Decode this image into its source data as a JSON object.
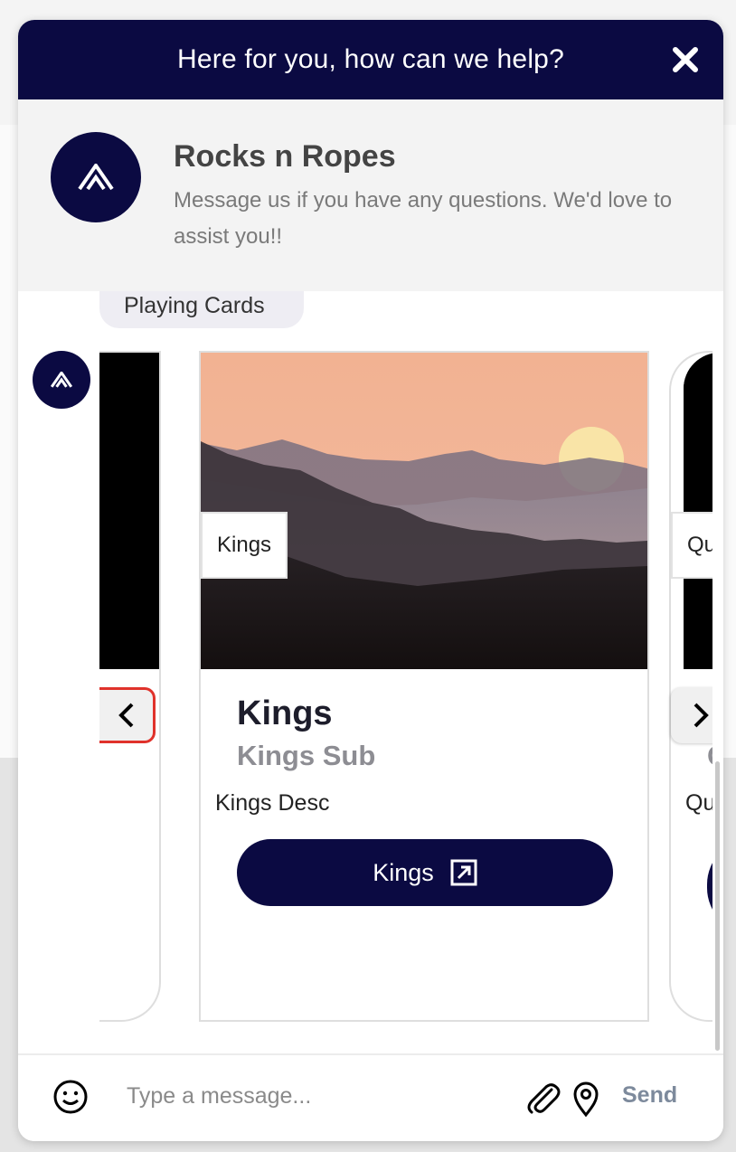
{
  "header": {
    "title": "Here for you, how can we help?"
  },
  "profile": {
    "name": "Rocks n Ropes",
    "description": "Message us if you have any questions. We'd love to assist you!!"
  },
  "conversation": {
    "previous_message": "Playing Cards"
  },
  "carousel": {
    "cards": [
      {
        "image_label": "Kings",
        "title": "Kings",
        "subtitle": "Kings Sub",
        "description": "Kings Desc",
        "button_label": "Kings",
        "button_icon": "external-link-icon"
      },
      {
        "image_label": "Que",
        "title": "Q",
        "description": "Que"
      }
    ]
  },
  "composer": {
    "placeholder": "Type a message...",
    "send_label": "Send"
  },
  "colors": {
    "brand_navy": "#0b0a42",
    "nav_highlight": "#e0322b",
    "send_gray": "#7d8a9c"
  }
}
